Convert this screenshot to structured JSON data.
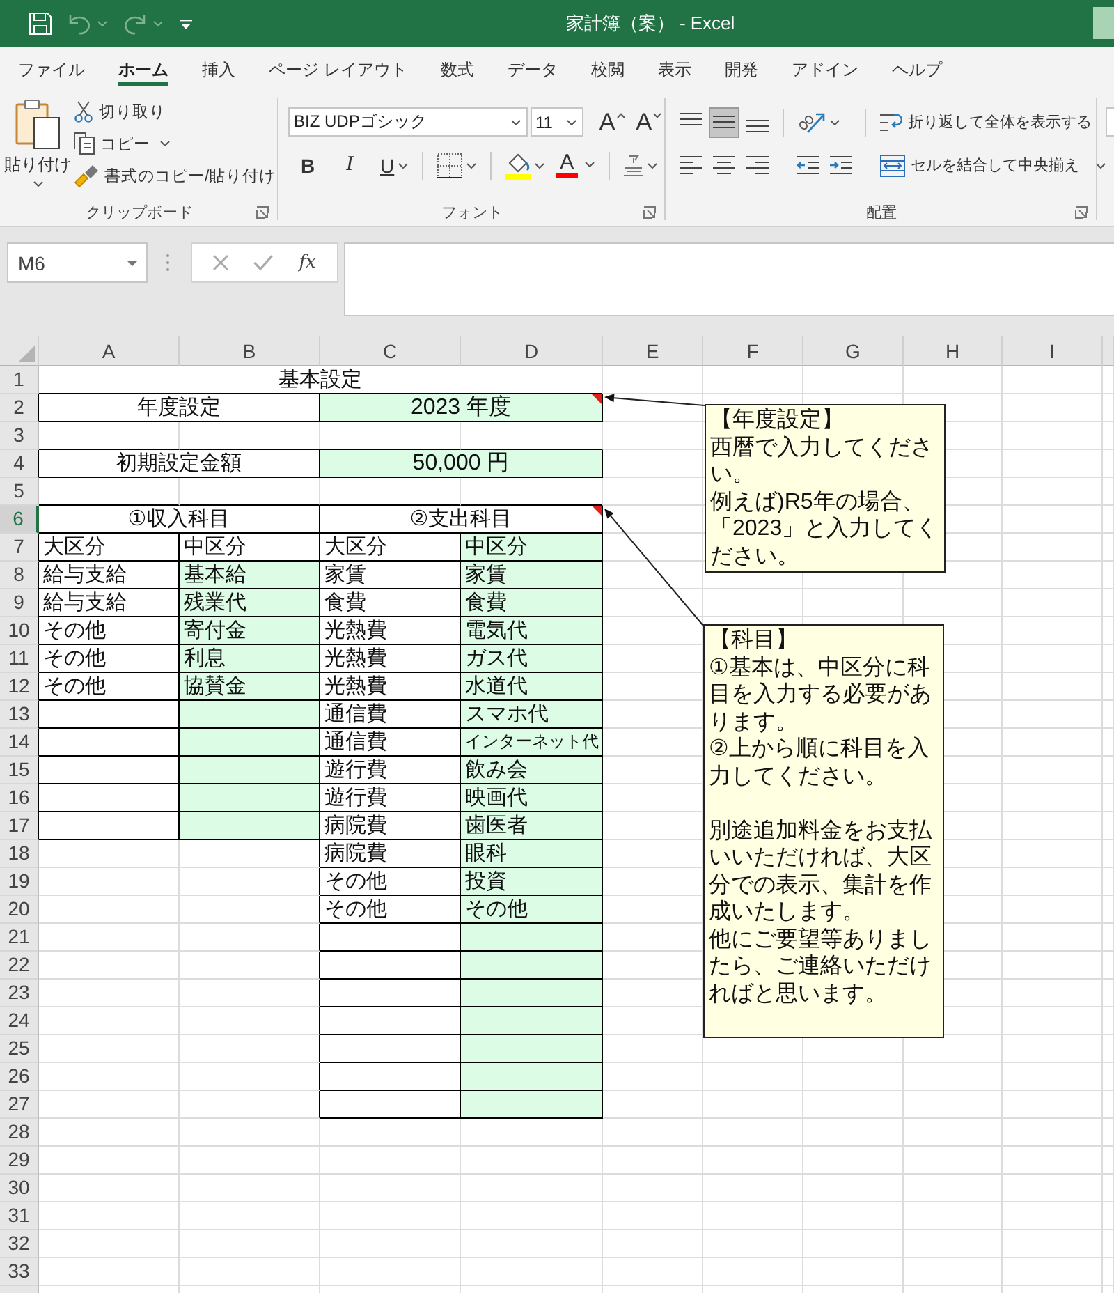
{
  "title_bar": {
    "title": "家計簿（案） - Excel",
    "quick_access": [
      {
        "kind": "save",
        "disabled": false
      },
      {
        "kind": "undo",
        "disabled": true
      },
      {
        "kind": "redo",
        "disabled": true
      },
      {
        "kind": "customize",
        "disabled": false
      }
    ]
  },
  "ribbon_tabs": [
    {
      "label": "ファイル",
      "selected": false
    },
    {
      "label": "ホーム",
      "selected": true
    },
    {
      "label": "挿入",
      "selected": false
    },
    {
      "label": "ページ レイアウト",
      "selected": false
    },
    {
      "label": "数式",
      "selected": false
    },
    {
      "label": "データ",
      "selected": false
    },
    {
      "label": "校閲",
      "selected": false
    },
    {
      "label": "表示",
      "selected": false
    },
    {
      "label": "開発",
      "selected": false
    },
    {
      "label": "アドイン",
      "selected": false
    },
    {
      "label": "ヘルプ",
      "selected": false
    }
  ],
  "clipboard": {
    "label": "クリップボード",
    "paste": "貼り付け",
    "cut": "切り取り",
    "copy": "コピー",
    "format_painter": "書式のコピー/貼り付け"
  },
  "font": {
    "label": "フォント",
    "font_name": "BIZ UDPゴシック",
    "font_size": "11",
    "grow": "A",
    "shrink": "A",
    "bold": "B",
    "italic": "I",
    "underline": "U",
    "font_color": "A"
  },
  "alignment": {
    "label": "配置",
    "vertical": [
      {
        "kind": "top",
        "selected": false
      },
      {
        "kind": "middle",
        "selected": true
      },
      {
        "kind": "bottom",
        "selected": false
      }
    ],
    "horizontal": [
      {
        "kind": "left",
        "selected": false
      },
      {
        "kind": "center",
        "selected": false
      },
      {
        "kind": "right",
        "selected": false
      }
    ],
    "wrap_text": "折り返して全体を表示する",
    "merge_center": "セルを結合して中央揃え"
  },
  "formula_bar": {
    "name_box": "M6",
    "function_label": "fx"
  },
  "sheet": {
    "columns": [
      "A",
      "B",
      "C",
      "D",
      "E",
      "F",
      "G",
      "H",
      "I"
    ],
    "rows": [
      {
        "label": "1",
        "selected": false
      },
      {
        "label": "2",
        "selected": false
      },
      {
        "label": "3",
        "selected": false
      },
      {
        "label": "4",
        "selected": false
      },
      {
        "label": "5",
        "selected": false
      },
      {
        "label": "6",
        "selected": true
      },
      {
        "label": "7",
        "selected": false
      },
      {
        "label": "8",
        "selected": false
      },
      {
        "label": "9",
        "selected": false
      },
      {
        "label": "10",
        "selected": false
      },
      {
        "label": "11",
        "selected": false
      },
      {
        "label": "12",
        "selected": false
      },
      {
        "label": "13",
        "selected": false
      },
      {
        "label": "14",
        "selected": false
      },
      {
        "label": "15",
        "selected": false
      },
      {
        "label": "16",
        "selected": false
      },
      {
        "label": "17",
        "selected": false
      },
      {
        "label": "18",
        "selected": false
      },
      {
        "label": "19",
        "selected": false
      },
      {
        "label": "20",
        "selected": false
      },
      {
        "label": "21",
        "selected": false
      },
      {
        "label": "22",
        "selected": false
      },
      {
        "label": "23",
        "selected": false
      },
      {
        "label": "24",
        "selected": false
      },
      {
        "label": "25",
        "selected": false
      },
      {
        "label": "26",
        "selected": false
      },
      {
        "label": "27",
        "selected": false
      },
      {
        "label": "28",
        "selected": false
      },
      {
        "label": "29",
        "selected": false
      },
      {
        "label": "30",
        "selected": false
      },
      {
        "label": "31",
        "selected": false
      },
      {
        "label": "32",
        "selected": false
      },
      {
        "label": "33",
        "selected": false
      }
    ],
    "title": "基本設定",
    "settings": [
      {
        "label": "年度設定",
        "value": "2023 年度",
        "input": true,
        "has_comment": true
      },
      {
        "label": "初期設定金額",
        "value": "50,000 円",
        "input": true,
        "has_comment": false
      }
    ],
    "sections": [
      {
        "title": "①収入科目",
        "has_comment": false,
        "columns": [
          {
            "header": "大区分",
            "header_input": false,
            "input": false
          },
          {
            "header": "中区分",
            "header_input": false,
            "input": true
          }
        ],
        "rows": [
          [
            "給与支給",
            "基本給"
          ],
          [
            "給与支給",
            "残業代"
          ],
          [
            "その他",
            "寄付金"
          ],
          [
            "その他",
            "利息"
          ],
          [
            "その他",
            "協賛金"
          ]
        ]
      },
      {
        "title": "②支出科目",
        "has_comment": true,
        "columns": [
          {
            "header": "大区分",
            "header_input": false,
            "input": false
          },
          {
            "header": "中区分",
            "header_input": true,
            "input": true
          }
        ],
        "rows": [
          [
            "家賃",
            "家賃"
          ],
          [
            "食費",
            "食費"
          ],
          [
            "光熱費",
            "電気代"
          ],
          [
            "光熱費",
            "ガス代"
          ],
          [
            "光熱費",
            "水道代"
          ],
          [
            "通信費",
            "スマホ代"
          ],
          [
            "通信費",
            "インターネット代"
          ],
          [
            "遊行費",
            "飲み会"
          ],
          [
            "遊行費",
            "映画代"
          ],
          [
            "病院費",
            "歯医者"
          ],
          [
            "病院費",
            "眼科"
          ],
          [
            "その他",
            "投資"
          ],
          [
            "その他",
            "その他"
          ]
        ]
      }
    ],
    "comments": [
      {
        "blocks": [
          [
            "【年度設定】",
            "西暦で入力してください。",
            "例えば)R5年の場合、「2023」と入力してください。"
          ]
        ]
      },
      {
        "blocks": [
          [
            "【科目】",
            "①基本は、中区分に科目を入力する必要があります。",
            "②上から順に科目を入力してください。"
          ],
          [
            "別途追加料金をお支払いいただければ、大区分での表示、集計を作成いたします。",
            "他にご要望等ありましたら、ご連絡いただければと思います。"
          ]
        ]
      }
    ]
  }
}
